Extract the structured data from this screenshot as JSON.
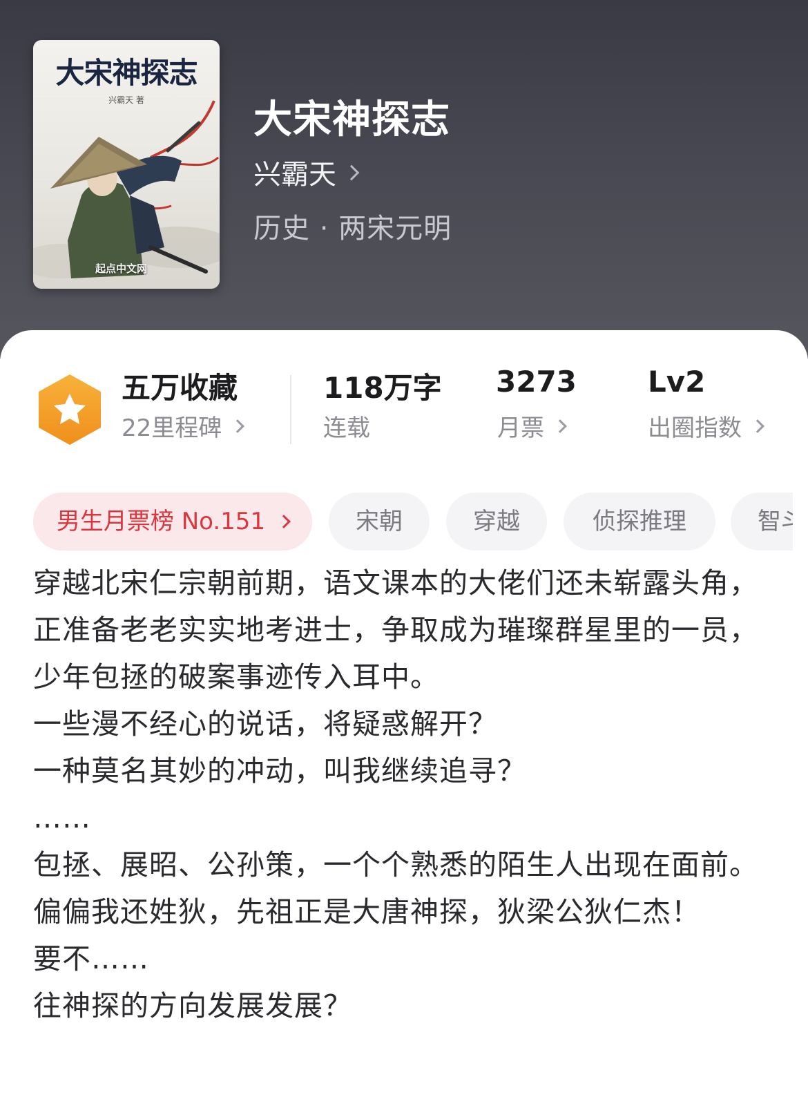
{
  "book": {
    "title": "大宋神探志",
    "author": "兴霸天",
    "category": "历史 · 两宋元明"
  },
  "cover": {
    "title": "大宋神探志",
    "author": "兴霸天 著",
    "publisher": "起点中文网"
  },
  "stats": {
    "favorites": {
      "main": "五万收藏",
      "sub": "22里程碑"
    },
    "words": {
      "main": "118万字",
      "sub": "连载"
    },
    "monthly_tickets": {
      "main": "3273",
      "sub": "月票"
    },
    "influence": {
      "main": "Lv2",
      "sub": "出圈指数"
    }
  },
  "tags": [
    {
      "label": "男生月票榜 No.151"
    },
    {
      "label": "宋朝"
    },
    {
      "label": "穿越"
    },
    {
      "label": "侦探推理"
    },
    {
      "label": "智斗"
    }
  ],
  "synopsis": [
    "穿越北宋仁宗朝前期，语文课本的大佬们还未崭露头角，正准备老老实实地考进士，争取成为璀璨群星里的一员，少年包拯的破案事迹传入耳中。",
    "一些漫不经心的说话，将疑惑解开？",
    "一种莫名其妙的冲动，叫我继续追寻？",
    "……",
    "包拯、展昭、公孙策，一个个熟悉的陌生人出现在面前。",
    "偏偏我还姓狄，先祖正是大唐神探，狄梁公狄仁杰！",
    "要不……",
    "往神探的方向发展发展？"
  ],
  "colors": {
    "header_bg": "#3a3a45",
    "rank_tag_bg": "#fbe8ea",
    "rank_tag_text": "#d9373e",
    "badge_orange": "#f4a52b"
  },
  "icons": [
    "star-badge-icon",
    "chevron-right-icon"
  ]
}
